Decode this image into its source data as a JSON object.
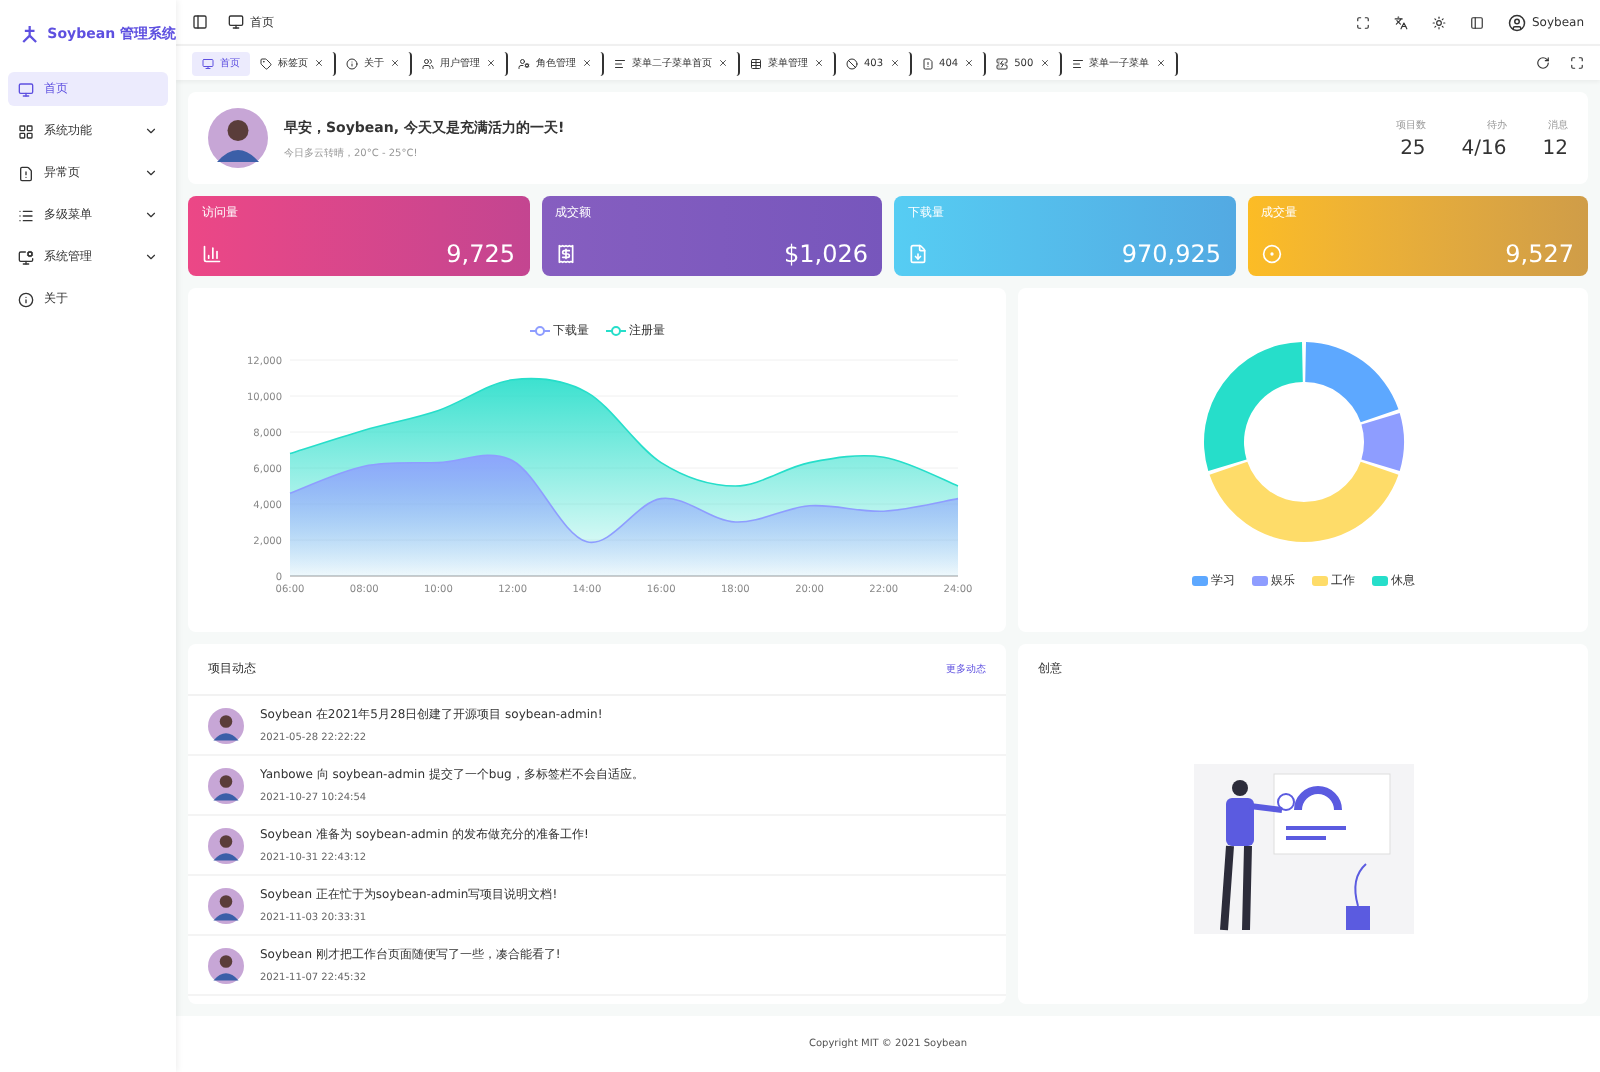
{
  "logo": {
    "title": "Soybean 管理系统"
  },
  "sidebar": {
    "items": [
      {
        "label": "首页",
        "kind": "link",
        "selected": true
      },
      {
        "label": "系统功能",
        "kind": "group",
        "selected": false,
        "expanded": false
      },
      {
        "label": "异常页",
        "kind": "group",
        "selected": false,
        "expanded": false
      },
      {
        "label": "多级菜单",
        "kind": "group",
        "selected": false,
        "expanded": false
      },
      {
        "label": "系统管理",
        "kind": "group",
        "selected": false,
        "expanded": false
      },
      {
        "label": "关于",
        "kind": "link",
        "selected": false
      }
    ]
  },
  "header": {
    "breadcrumb": "首页",
    "user": "Soybean"
  },
  "tabs": [
    {
      "label": "首页",
      "selected": true,
      "closable": false
    },
    {
      "label": "标签页",
      "selected": false,
      "closable": true
    },
    {
      "label": "关于",
      "selected": false,
      "closable": true
    },
    {
      "label": "用户管理",
      "selected": false,
      "closable": true
    },
    {
      "label": "角色管理",
      "selected": false,
      "closable": true
    },
    {
      "label": "菜单二子菜单首页",
      "selected": false,
      "closable": true
    },
    {
      "label": "菜单管理",
      "selected": false,
      "closable": true
    },
    {
      "label": "403",
      "selected": false,
      "closable": true
    },
    {
      "label": "404",
      "selected": false,
      "closable": true
    },
    {
      "label": "500",
      "selected": false,
      "closable": true
    },
    {
      "label": "菜单一子菜单",
      "selected": false,
      "closable": true
    }
  ],
  "greeting": {
    "title": "早安，Soybean, 今天又是充满活力的一天!",
    "subtitle": "今日多云转晴，20°C - 25°C!",
    "stats": [
      {
        "label": "项目数",
        "value": "25"
      },
      {
        "label": "待办",
        "value": "4/16"
      },
      {
        "label": "消息",
        "value": "12"
      }
    ]
  },
  "cards": [
    {
      "title": "访问量",
      "value": "9,725",
      "color": "#ec4786"
    },
    {
      "title": "成交额",
      "value": "$1,026",
      "color": "#865ec0"
    },
    {
      "title": "下载量",
      "value": "970,925",
      "color": "#56cdf3"
    },
    {
      "title": "成交量",
      "value": "9,527",
      "color": "#fcbc25"
    }
  ],
  "line_chart": {
    "chart_data": {
      "type": "area",
      "stacked": true,
      "grid": true,
      "legend": "top",
      "x": [
        "06:00",
        "08:00",
        "10:00",
        "12:00",
        "14:00",
        "16:00",
        "18:00",
        "20:00",
        "22:00",
        "24:00"
      ],
      "series": [
        {
          "name": "下载量",
          "color": "#8e9dff",
          "values": [
            4600,
            6100,
            6300,
            6400,
            1900,
            4300,
            3000,
            3900,
            3600,
            4300
          ]
        },
        {
          "name": "注册量",
          "color": "#26deca",
          "values": [
            2200,
            2000,
            2900,
            4500,
            8300,
            2000,
            2000,
            2400,
            3000,
            700
          ]
        }
      ],
      "ylim": [
        0,
        12000
      ],
      "yticks": [
        {
          "value": 0,
          "label": "0"
        },
        {
          "value": 2000,
          "label": "2,000"
        },
        {
          "value": 4000,
          "label": "4,000"
        },
        {
          "value": 6000,
          "label": "6,000"
        },
        {
          "value": 8000,
          "label": "8,000"
        },
        {
          "value": 10000,
          "label": "10,000"
        },
        {
          "value": 12000,
          "label": "12,000"
        }
      ]
    }
  },
  "pie_chart": {
    "chart_data": {
      "type": "donut",
      "legend": "bottom",
      "categories": [
        "学习",
        "娱乐",
        "工作",
        "休息"
      ],
      "series": [
        {
          "values": [
            20,
            10,
            40,
            30
          ]
        }
      ],
      "colors": [
        "#5da8ff",
        "#8e9dff",
        "#fedc69",
        "#26deca"
      ]
    }
  },
  "activity": {
    "title": "项目动态",
    "more": "更多动态",
    "items": [
      {
        "text": "Soybean 在2021年5月28日创建了开源项目 soybean-admin!",
        "time": "2021-05-28 22:22:22"
      },
      {
        "text": "Yanbowe 向 soybean-admin 提交了一个bug，多标签栏不会自适应。",
        "time": "2021-10-27 10:24:54"
      },
      {
        "text": "Soybean 准备为 soybean-admin 的发布做充分的准备工作!",
        "time": "2021-10-31 22:43:12"
      },
      {
        "text": "Soybean 正在忙于为soybean-admin写项目说明文档!",
        "time": "2021-11-03 20:33:31"
      },
      {
        "text": "Soybean 刚才把工作台页面随便写了一些，凑合能看了!",
        "time": "2021-11-07 22:45:32"
      }
    ]
  },
  "creativity": {
    "title": "创意"
  },
  "footer": "Copyright MIT © 2021 Soybean"
}
